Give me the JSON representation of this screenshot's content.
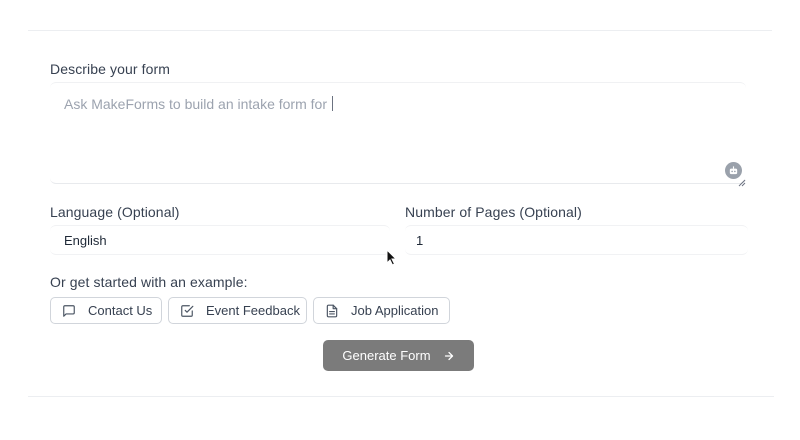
{
  "form": {
    "describe_label": "Describe your form",
    "describe_placeholder": "Ask MakeForms to build an intake form for ",
    "language_label": "Language (Optional)",
    "language_value": "English",
    "pages_label": "Number of Pages (Optional)",
    "pages_value": "1",
    "examples_label": "Or get started with an example:",
    "examples": [
      {
        "label": "Contact Us",
        "icon": "message-square-icon"
      },
      {
        "label": "Event Feedback",
        "icon": "check-square-icon"
      },
      {
        "label": "Job Application",
        "icon": "file-text-icon"
      }
    ],
    "generate_label": "Generate Form"
  },
  "colors": {
    "primary_button": "#7b7b7b",
    "text": "#374151",
    "placeholder": "#9ca3af"
  }
}
